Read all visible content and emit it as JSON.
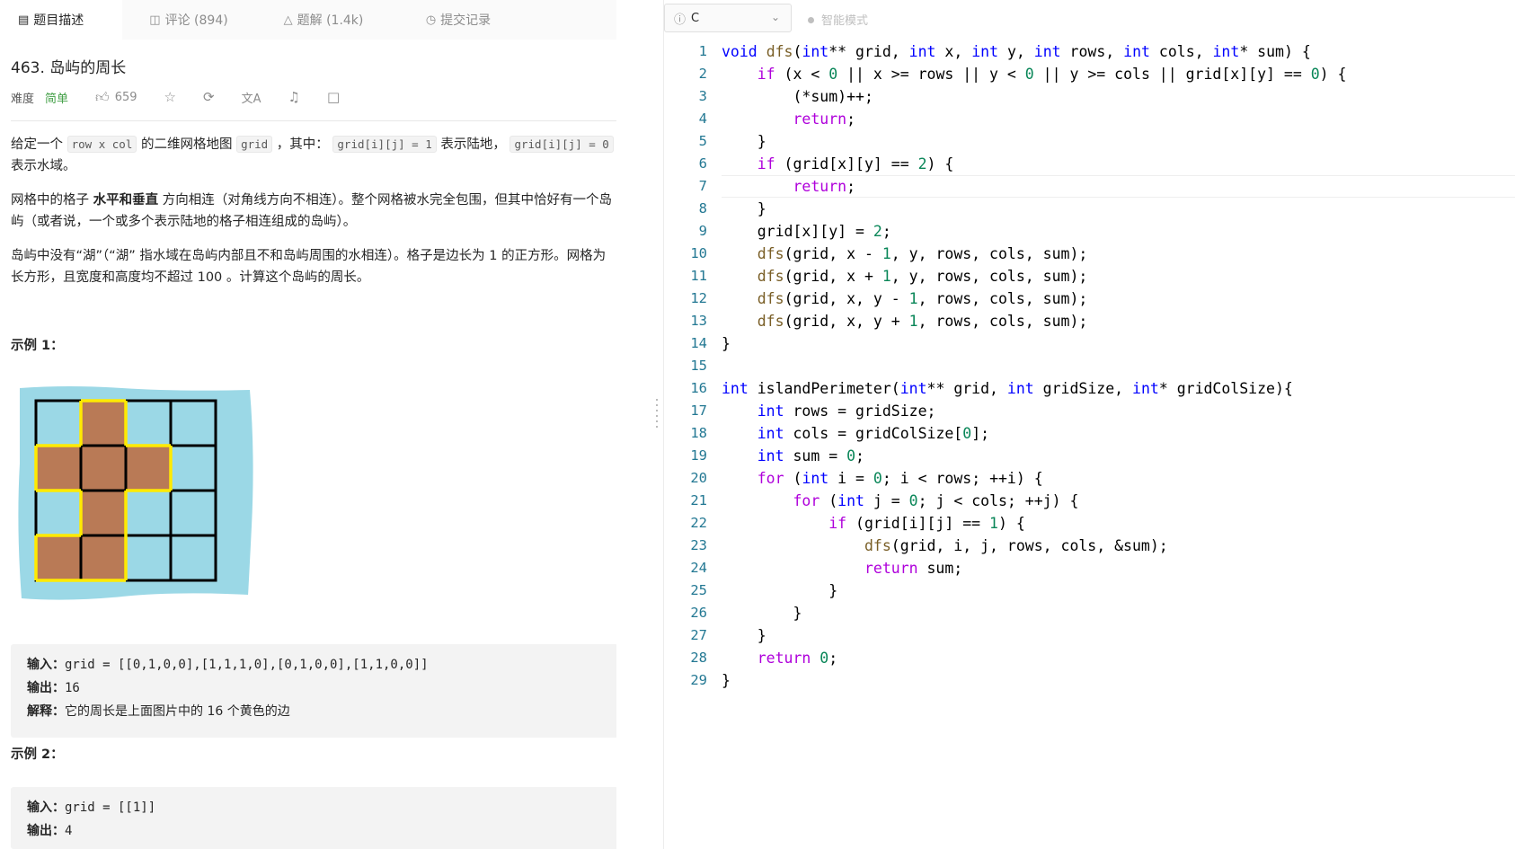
{
  "tabs": [
    {
      "icon": "description-icon",
      "label": "题目描述"
    },
    {
      "icon": "comment-icon",
      "label": "评论 (894)"
    },
    {
      "icon": "flask-icon",
      "label": "题解 (1.4k)"
    },
    {
      "icon": "history-icon",
      "label": "提交记录"
    }
  ],
  "problem": {
    "title": "463. 岛屿的周长",
    "difficulty_label": "难度",
    "difficulty": "简单",
    "likes": "659"
  },
  "description": {
    "p1_a": "给定一个",
    "p1_code1": "row x col",
    "p1_b": "的二维网格地图",
    "p1_code2": "grid",
    "p1_c": "，其中：",
    "p1_code3": "grid[i][j] = 1",
    "p1_d": "表示陆地，",
    "p1_code4": "grid[i][j] = 0",
    "p1_e": "表示水域。",
    "p2_a": "网格中的格子 ",
    "p2_bold": "水平和垂直",
    "p2_b": " 方向相连（对角线方向不相连）。整个网格被水完全包围，但其中恰好有一个岛屿（或者说，一个或多个表示陆地的格子相连组成的岛屿）。",
    "p3": "岛屿中没有“湖”（“湖” 指水域在岛屿内部且不和岛屿周围的水相连）。格子是边长为 1 的正方形。网格为长方形，且宽度和高度均不超过 100 。计算这个岛屿的周长。"
  },
  "example1": {
    "title": "示例 1：",
    "grid": [
      [
        0,
        1,
        0,
        0
      ],
      [
        1,
        1,
        1,
        0
      ],
      [
        0,
        1,
        0,
        0
      ],
      [
        1,
        1,
        0,
        0
      ]
    ],
    "input_label": "输入：",
    "input": "grid = [[0,1,0,0],[1,1,1,0],[0,1,0,0],[1,1,0,0]]",
    "output_label": "输出：",
    "output": "16",
    "explain_label": "解释：",
    "explain": "它的周长是上面图片中的 16 个黄色的边"
  },
  "example2": {
    "title": "示例 2：",
    "input_label": "输入：",
    "input": "grid = [[1]]",
    "output_label": "输出：",
    "output": "4"
  },
  "editor": {
    "language": "C",
    "smart_mode": "智能模式",
    "colors": {
      "keyword": "#0000ff",
      "control": "#af00db",
      "number": "#098658",
      "function": "#795e26",
      "line_number": "#237893"
    },
    "lines": [
      "void dfs(int** grid, int x, int y, int rows, int cols, int* sum) {",
      "    if (x < 0 || x >= rows || y < 0 || y >= cols || grid[x][y] == 0) {",
      "        (*sum)++;",
      "        return;",
      "    }",
      "    if (grid[x][y] == 2) {",
      "        return;",
      "    }",
      "    grid[x][y] = 2;",
      "    dfs(grid, x - 1, y, rows, cols, sum);",
      "    dfs(grid, x + 1, y, rows, cols, sum);",
      "    dfs(grid, x, y - 1, rows, cols, sum);",
      "    dfs(grid, x, y + 1, rows, cols, sum);",
      "}",
      "",
      "int islandPerimeter(int** grid, int gridSize, int* gridColSize){",
      "    int rows = gridSize;",
      "    int cols = gridColSize[0];",
      "    int sum = 0;",
      "    for (int i = 0; i < rows; ++i) {",
      "        for (int j = 0; j < cols; ++j) {",
      "            if (grid[i][j] == 1) {",
      "                dfs(grid, i, j, rows, cols, &sum);",
      "                return sum;",
      "            }",
      "        }",
      "    }",
      "    return 0;",
      "}"
    ],
    "current_line": 7
  }
}
